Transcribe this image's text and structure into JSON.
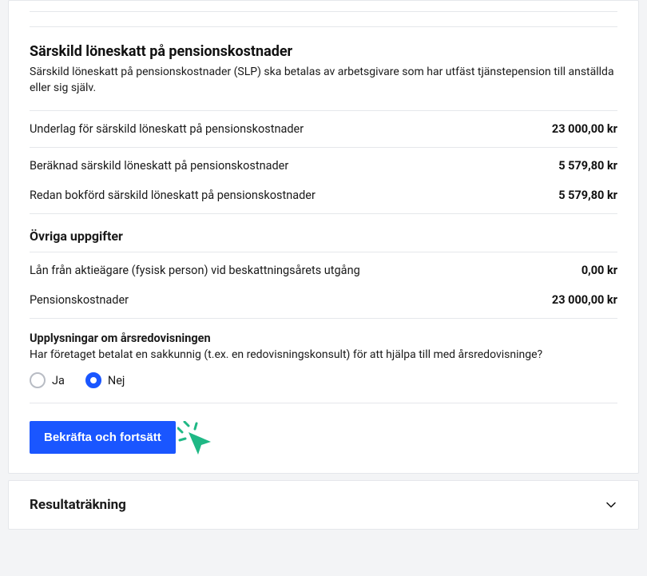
{
  "section1": {
    "title": "Särskild löneskatt på pensionskostnader",
    "description": "Särskild löneskatt på pensionskostnader (SLP) ska betalas av arbetsgivare som har utfäst tjänstepension till anställda eller sig själv.",
    "rows": [
      {
        "label": "Underlag för särskild löneskatt på pensionskostnader",
        "value": "23 000,00 kr"
      },
      {
        "label": "Beräknad särskild löneskatt på pensionskostnader",
        "value": "5 579,80 kr"
      },
      {
        "label": "Redan bokförd särskild löneskatt på pensionskostnader",
        "value": "5 579,80 kr"
      }
    ]
  },
  "section2": {
    "title": "Övriga uppgifter",
    "rows": [
      {
        "label": "Lån från aktieägare (fysisk person) vid beskattningsårets utgång",
        "value": "0,00 kr"
      },
      {
        "label": "Pensionskostnader",
        "value": "23 000,00 kr"
      }
    ]
  },
  "question": {
    "title": "Upplysningar om årsredovisningen",
    "text": "Har företaget betalat en sakkunnig (t.ex. en redovisningskonsult) för att hjälpa till med årsredovisninge?",
    "options": {
      "yes": "Ja",
      "no": "Nej"
    },
    "selected": "no"
  },
  "confirm_button": "Bekräfta och fortsätt",
  "accordion": {
    "title": "Resultaträkning"
  }
}
